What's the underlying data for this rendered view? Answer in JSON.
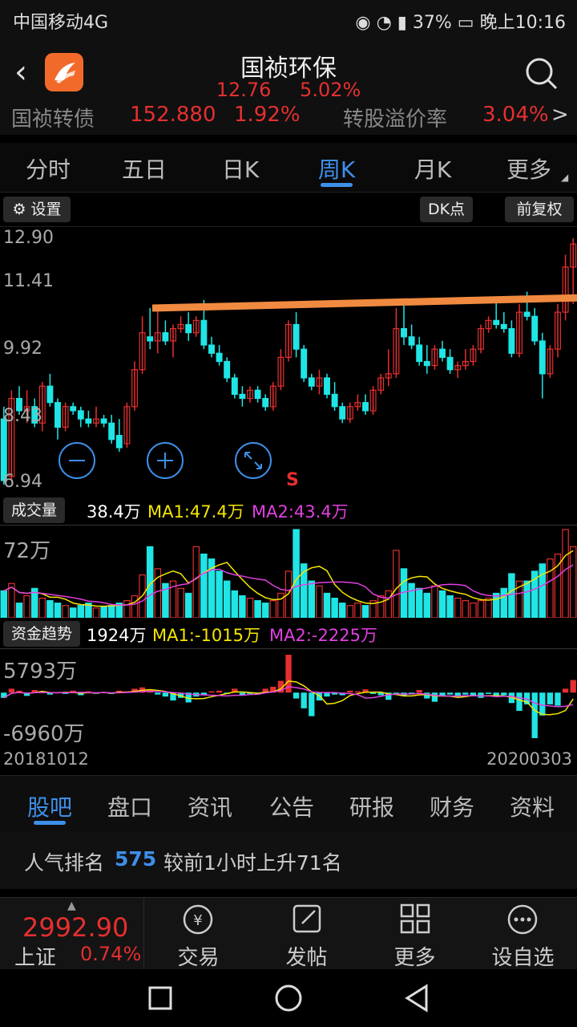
{
  "status_bar": {
    "carrier": "中国移动4G",
    "battery": "37%",
    "time": "晚上10:16"
  },
  "header": {
    "stock_name": "国祯环保",
    "price": "12.76",
    "change_pct": "5.02%"
  },
  "bond_ticker": {
    "name": "国祯转债",
    "price": "152.880",
    "change": "1.92%",
    "premium_label": "转股溢价率",
    "premium_value": "3.04%",
    "arrow": ">"
  },
  "period_tabs": [
    "分时",
    "五日",
    "日K",
    "周K",
    "月K",
    "更多"
  ],
  "active_period": "周K",
  "chart_controls": {
    "settings": "设置",
    "dk": "DK点",
    "adjust": "前复权",
    "s_marker": "S"
  },
  "chart_data": [
    {
      "type": "candlestick",
      "name": "周K",
      "y_ticks": [
        "12.90",
        "11.41",
        "9.92",
        "8.43",
        "6.94"
      ],
      "ylim": [
        6.94,
        12.9
      ],
      "resistance_line": [
        11.2,
        11.45
      ],
      "color_up": "#e52f2f",
      "color_down": "#20e5e5",
      "ohlc": [
        [
          8.5,
          8.8,
          6.9,
          7.0
        ],
        [
          7.1,
          9.2,
          7.0,
          9.0
        ],
        [
          9.0,
          9.3,
          8.6,
          8.7
        ],
        [
          8.7,
          9.2,
          8.4,
          8.8
        ],
        [
          8.8,
          9.0,
          8.3,
          8.4
        ],
        [
          8.4,
          9.4,
          8.2,
          9.3
        ],
        [
          9.3,
          9.6,
          8.8,
          8.9
        ],
        [
          8.9,
          9.0,
          8.0,
          8.3
        ],
        [
          8.3,
          8.9,
          8.2,
          8.8
        ],
        [
          8.8,
          8.9,
          8.6,
          8.7
        ],
        [
          8.7,
          8.8,
          8.3,
          8.5
        ],
        [
          8.5,
          8.7,
          8.3,
          8.4
        ],
        [
          8.4,
          8.8,
          8.3,
          8.5
        ],
        [
          8.5,
          8.6,
          8.3,
          8.4
        ],
        [
          8.4,
          8.6,
          7.9,
          8.0
        ],
        [
          8.1,
          8.5,
          7.7,
          7.8
        ],
        [
          7.9,
          8.9,
          7.8,
          8.8
        ],
        [
          8.8,
          9.9,
          8.7,
          9.7
        ],
        [
          9.7,
          11.0,
          9.6,
          10.6
        ],
        [
          10.5,
          11.2,
          10.2,
          10.4
        ],
        [
          10.4,
          11.2,
          10.1,
          10.6
        ],
        [
          10.6,
          10.9,
          10.3,
          10.4
        ],
        [
          10.4,
          10.8,
          10.0,
          10.7
        ],
        [
          10.7,
          11.0,
          10.6,
          10.8
        ],
        [
          10.8,
          11.1,
          10.4,
          10.6
        ],
        [
          10.6,
          11.0,
          10.5,
          10.9
        ],
        [
          10.9,
          11.4,
          10.2,
          10.3
        ],
        [
          10.3,
          10.5,
          10.0,
          10.1
        ],
        [
          10.1,
          10.3,
          9.8,
          9.9
        ],
        [
          9.9,
          10.0,
          9.4,
          9.5
        ],
        [
          9.5,
          9.6,
          9.0,
          9.1
        ],
        [
          9.1,
          9.3,
          8.8,
          9.0
        ],
        [
          9.0,
          9.3,
          8.9,
          9.2
        ],
        [
          9.2,
          9.3,
          8.9,
          9.0
        ],
        [
          9.0,
          9.1,
          8.7,
          8.8
        ],
        [
          8.8,
          9.4,
          8.7,
          9.3
        ],
        [
          9.3,
          10.2,
          9.2,
          10.0
        ],
        [
          10.0,
          10.9,
          9.9,
          10.8
        ],
        [
          10.8,
          11.1,
          10.0,
          10.2
        ],
        [
          10.2,
          10.3,
          9.4,
          9.5
        ],
        [
          9.5,
          9.6,
          9.2,
          9.3
        ],
        [
          9.3,
          9.7,
          9.1,
          9.5
        ],
        [
          9.5,
          9.6,
          9.0,
          9.1
        ],
        [
          9.1,
          9.4,
          8.7,
          8.8
        ],
        [
          8.8,
          8.9,
          8.4,
          8.5
        ],
        [
          8.5,
          8.9,
          8.4,
          8.8
        ],
        [
          8.8,
          9.1,
          8.7,
          8.9
        ],
        [
          8.9,
          9.1,
          8.6,
          8.7
        ],
        [
          8.7,
          9.3,
          8.6,
          9.2
        ],
        [
          9.2,
          9.6,
          9.1,
          9.5
        ],
        [
          9.5,
          10.2,
          9.3,
          9.6
        ],
        [
          9.6,
          11.2,
          9.5,
          10.7
        ],
        [
          10.7,
          11.3,
          10.3,
          10.5
        ],
        [
          10.5,
          10.8,
          10.2,
          10.3
        ],
        [
          10.3,
          10.5,
          9.8,
          9.9
        ],
        [
          9.9,
          10.3,
          9.6,
          9.8
        ],
        [
          9.8,
          10.3,
          9.7,
          10.2
        ],
        [
          10.2,
          10.4,
          9.9,
          10.0
        ],
        [
          10.0,
          10.2,
          9.6,
          9.7
        ],
        [
          9.7,
          9.9,
          9.5,
          9.8
        ],
        [
          9.8,
          10.2,
          9.7,
          9.9
        ],
        [
          9.9,
          10.3,
          9.8,
          10.2
        ],
        [
          10.2,
          10.8,
          10.1,
          10.7
        ],
        [
          10.7,
          11.0,
          10.6,
          10.9
        ],
        [
          10.9,
          11.4,
          10.7,
          10.8
        ],
        [
          10.8,
          11.1,
          10.6,
          10.7
        ],
        [
          10.7,
          10.9,
          10.0,
          10.1
        ],
        [
          10.1,
          11.3,
          10.0,
          11.1
        ],
        [
          11.1,
          11.6,
          10.9,
          11.0
        ],
        [
          11.0,
          11.2,
          10.3,
          10.4
        ],
        [
          10.4,
          10.6,
          9.0,
          9.6
        ],
        [
          9.6,
          10.3,
          9.5,
          10.2
        ],
        [
          10.2,
          11.3,
          10.0,
          11.1
        ],
        [
          11.1,
          12.5,
          10.9,
          12.2
        ],
        [
          12.2,
          12.9,
          11.3,
          12.76
        ]
      ]
    },
    {
      "type": "bar",
      "name": "成交量",
      "top_label": "72万",
      "legend": {
        "label": "成交量",
        "value": "38.4万",
        "ma1": "MA1:47.4万",
        "ma2": "MA2:43.4万"
      },
      "values": [
        22,
        28,
        12,
        18,
        24,
        16,
        14,
        12,
        10,
        8,
        10,
        12,
        8,
        9,
        10,
        12,
        14,
        18,
        35,
        58,
        40,
        28,
        30,
        24,
        20,
        58,
        52,
        48,
        38,
        30,
        22,
        18,
        16,
        14,
        12,
        14,
        20,
        38,
        72,
        44,
        30,
        26,
        20,
        16,
        12,
        10,
        12,
        10,
        14,
        18,
        22,
        55,
        40,
        28,
        24,
        20,
        26,
        22,
        18,
        16,
        14,
        12,
        14,
        16,
        20,
        24,
        36,
        30,
        30,
        38,
        44,
        48,
        52,
        72,
        58
      ],
      "ylim": [
        0,
        72
      ]
    },
    {
      "type": "bar",
      "name": "资金趋势",
      "top_label": "5793万",
      "bottom_label": "-6960万",
      "legend": {
        "label": "资金趋势",
        "value": "1924万",
        "ma1": "MA1:-1015万",
        "ma2": "MA2:-2225万"
      },
      "values": [
        -800,
        600,
        300,
        -500,
        400,
        200,
        -300,
        100,
        -200,
        300,
        -400,
        200,
        -100,
        100,
        -200,
        300,
        200,
        600,
        800,
        400,
        -300,
        -600,
        -1200,
        -800,
        -1500,
        -600,
        -400,
        200,
        300,
        -200,
        600,
        -400,
        -200,
        -300,
        600,
        900,
        1800,
        5793,
        -900,
        -2400,
        -3600,
        -1200,
        -600,
        -300,
        -400,
        300,
        200,
        500,
        -200,
        -400,
        -1100,
        -300,
        -500,
        -200,
        400,
        -900,
        -1400,
        -500,
        -300,
        -600,
        -300,
        -500,
        -800,
        -200,
        -600,
        -400,
        -1600,
        -2800,
        -1800,
        -6960,
        -3500,
        -1800,
        -2000,
        600,
        1924
      ],
      "ylim": [
        -6960,
        5793
      ]
    }
  ],
  "date_range": {
    "start": "20181012",
    "end": "20200303"
  },
  "lower_tabs": [
    "股吧",
    "盘口",
    "资讯",
    "公告",
    "研报",
    "财务",
    "资料"
  ],
  "active_lower_tab": "股吧",
  "rank": {
    "prefix": "人气排名",
    "number": "575",
    "suffix": "较前1小时上升71名"
  },
  "bottom_bar": {
    "index_value": "2992.90",
    "index_name": "上证",
    "index_change": "0.74%",
    "trade": "交易",
    "post": "发帖",
    "more": "更多",
    "set_watch": "设自选"
  },
  "colors": {
    "up": "#e52f2f",
    "down": "#20e5e5",
    "accent": "#3e8fe8",
    "ma1": "#f5e600",
    "ma2": "#e040e0",
    "resistance": "#f08a40"
  }
}
